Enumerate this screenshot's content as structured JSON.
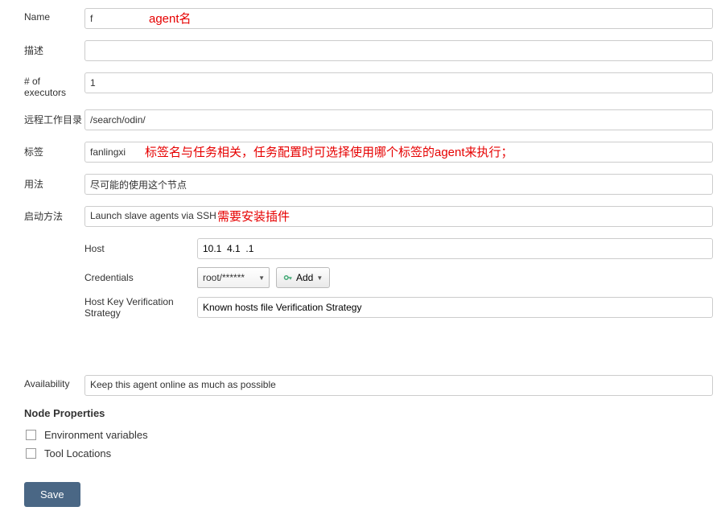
{
  "form": {
    "name_label": "Name",
    "name_value": "f",
    "desc_label": "描述",
    "desc_value": "",
    "executors_label": "# of executors",
    "executors_value": "1",
    "remote_dir_label": "远程工作目录",
    "remote_dir_value": "/search/odin/",
    "tags_label": "标签",
    "tags_value": "fanlingxi",
    "usage_label": "用法",
    "usage_value": "尽可能的使用这个节点",
    "launch_label": "启动方法",
    "launch_value": "Launch slave agents via SSH",
    "host_label": "Host",
    "host_value": "10.1  4.1  .1",
    "credentials_label": "Credentials",
    "credentials_value": "root/******",
    "add_button_label": "Add",
    "hostkey_label": "Host Key Verification Strategy",
    "hostkey_value": "Known hosts file Verification Strategy",
    "availability_label": "Availability",
    "availability_value": "Keep this agent online as much as possible"
  },
  "section": {
    "node_properties": "Node Properties",
    "env_vars": "Environment variables",
    "tool_locations": "Tool Locations"
  },
  "buttons": {
    "save": "Save"
  },
  "annotations": {
    "name": "agent名",
    "tags": "标签名与任务相关，任务配置时可选择使用哪个标签的agent来执行；",
    "launch": "需要安装插件"
  }
}
